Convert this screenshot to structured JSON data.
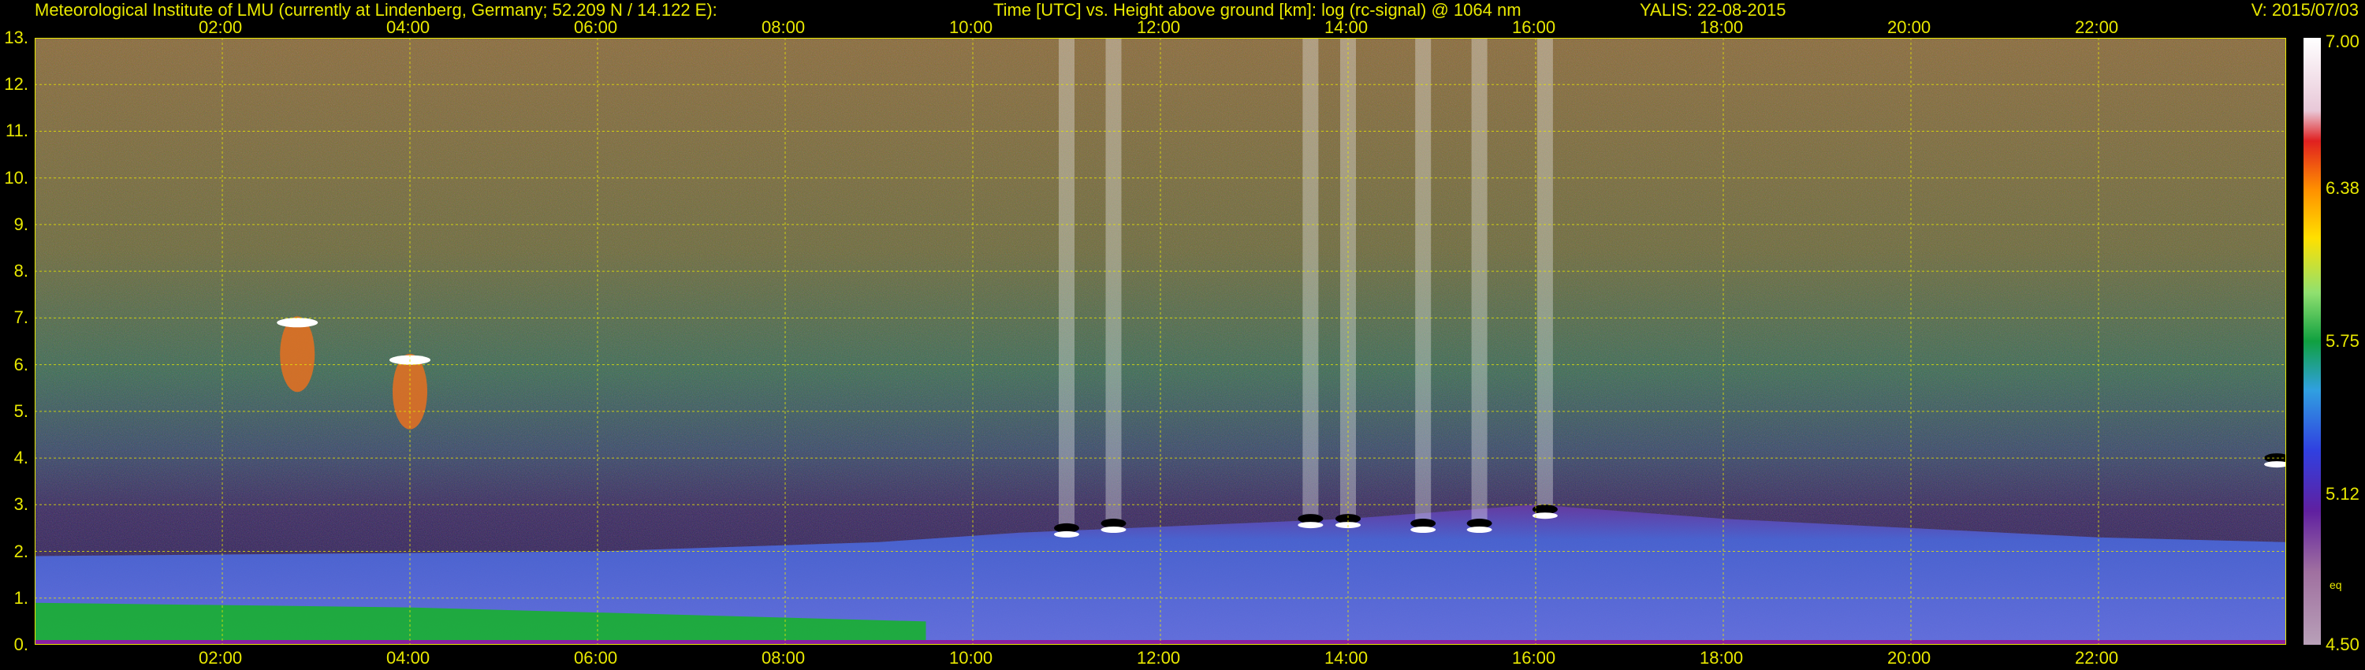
{
  "header": {
    "institute": "Meteorological Institute of LMU (currently at Lindenberg, Germany; 52.209 N / 14.122 E):",
    "title": "Time [UTC] vs. Height above ground [km]: log (rc-signal) @ 1064 nm",
    "station": "YALIS: 22-08-2015",
    "version": "V: 2015/07/03"
  },
  "chart_data": {
    "type": "heatmap",
    "title": "Time [UTC] vs. Height above ground [km]: log (rc-signal) @ 1064 nm",
    "x_ticks": [
      "02:00",
      "04:00",
      "06:00",
      "08:00",
      "10:00",
      "12:00",
      "14:00",
      "16:00",
      "18:00",
      "20:00",
      "22:00"
    ],
    "x_tick_hours": [
      2,
      4,
      6,
      8,
      10,
      12,
      14,
      16,
      18,
      20,
      22
    ],
    "xlim_hours": [
      0,
      24
    ],
    "y_ticks": [
      "0.",
      "1.",
      "2.",
      "3.",
      "4.",
      "5.",
      "6.",
      "7.",
      "8.",
      "9.",
      "10.",
      "11.",
      "12.",
      "13."
    ],
    "ylim_km": [
      0,
      13
    ],
    "grid": true,
    "colorbar": {
      "ticks": [
        "7.00",
        "6.38",
        "5.75",
        "5.12",
        "4.50"
      ],
      "range": [
        4.5,
        7.0
      ],
      "extra_label": "eq"
    },
    "features": {
      "boundary_layer_top_km": [
        [
          0,
          1.9
        ],
        [
          6,
          2.0
        ],
        [
          9,
          2.2
        ],
        [
          10.5,
          2.4
        ],
        [
          14,
          2.7
        ],
        [
          16,
          3.0
        ],
        [
          18,
          2.7
        ],
        [
          22,
          2.3
        ],
        [
          24,
          2.2
        ]
      ],
      "surface_green_layer_km": [
        [
          0,
          0.9
        ],
        [
          4,
          0.8
        ],
        [
          9.5,
          0.5
        ]
      ],
      "cloud_tops": [
        {
          "time": 2.8,
          "height_km": 6.9
        },
        {
          "time": 4.0,
          "height_km": 6.1
        },
        {
          "time": 11.0,
          "height_km": 2.5
        },
        {
          "time": 11.5,
          "height_km": 2.6
        },
        {
          "time": 13.6,
          "height_km": 2.7
        },
        {
          "time": 14.0,
          "height_km": 2.7
        },
        {
          "time": 14.8,
          "height_km": 2.6
        },
        {
          "time": 15.4,
          "height_km": 2.6
        },
        {
          "time": 16.1,
          "height_km": 2.9
        },
        {
          "time": 23.9,
          "height_km": 4.0
        }
      ]
    },
    "colors": {
      "background": "#000000",
      "text": "#e8e800",
      "grid": "#e8e800"
    }
  }
}
